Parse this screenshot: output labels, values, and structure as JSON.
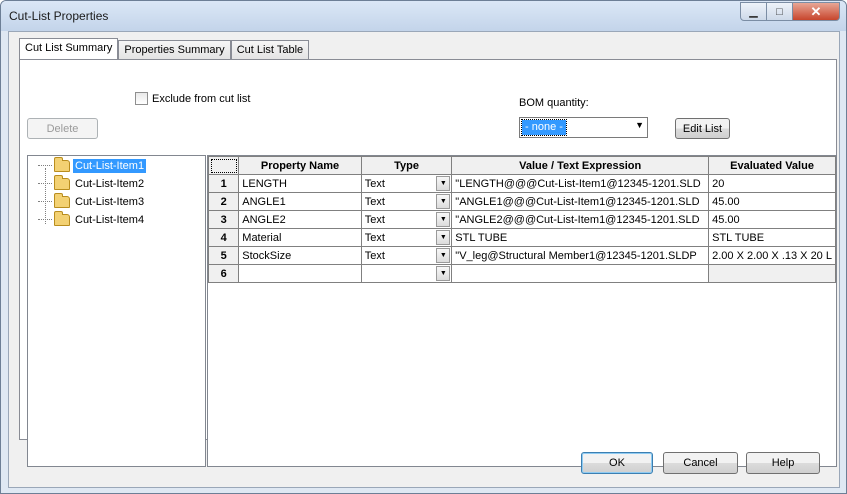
{
  "window": {
    "title": "Cut-List Properties",
    "min_glyph": "▁",
    "max_glyph": "□",
    "close_glyph": "✕"
  },
  "tabs": [
    {
      "label": "Cut List Summary",
      "active": true
    },
    {
      "label": "Properties Summary",
      "active": false
    },
    {
      "label": "Cut List Table",
      "active": false
    }
  ],
  "toolbar": {
    "delete_label": "Delete",
    "exclude_checkbox_label": "Exclude from cut list",
    "bom_quantity_label": "BOM quantity:",
    "bom_quantity_value": "- none -",
    "edit_list_label": "Edit List"
  },
  "tree": {
    "items": [
      {
        "label": "Cut-List-Item1",
        "selected": true
      },
      {
        "label": "Cut-List-Item2",
        "selected": false
      },
      {
        "label": "Cut-List-Item3",
        "selected": false
      },
      {
        "label": "Cut-List-Item4",
        "selected": false
      }
    ]
  },
  "grid": {
    "columns": [
      "Property Name",
      "Type",
      "Value / Text Expression",
      "Evaluated Value"
    ],
    "rows": [
      {
        "num": "1",
        "name": "LENGTH",
        "type": "Text",
        "value": "\"LENGTH@@@Cut-List-Item1@12345-1201.SLD",
        "evaluated": "20"
      },
      {
        "num": "2",
        "name": "ANGLE1",
        "type": "Text",
        "value": "\"ANGLE1@@@Cut-List-Item1@12345-1201.SLD",
        "evaluated": "45.00"
      },
      {
        "num": "3",
        "name": "ANGLE2",
        "type": "Text",
        "value": "\"ANGLE2@@@Cut-List-Item1@12345-1201.SLD",
        "evaluated": "45.00"
      },
      {
        "num": "4",
        "name": "Material",
        "type": "Text",
        "value": "STL TUBE",
        "evaluated": "STL TUBE"
      },
      {
        "num": "5",
        "name": "StockSize",
        "type": "Text",
        "value": "\"V_leg@Structural Member1@12345-1201.SLDP",
        "evaluated": "2.00 X 2.00 X .13 X 20 L"
      },
      {
        "num": "6",
        "name": "",
        "type": "",
        "value": "",
        "evaluated": ""
      }
    ]
  },
  "footer": {
    "ok_label": "OK",
    "cancel_label": "Cancel",
    "help_label": "Help"
  },
  "colors": {
    "selection": "#3399ff",
    "title_bar": "#c3d4ea",
    "close_button": "#c7452c"
  }
}
